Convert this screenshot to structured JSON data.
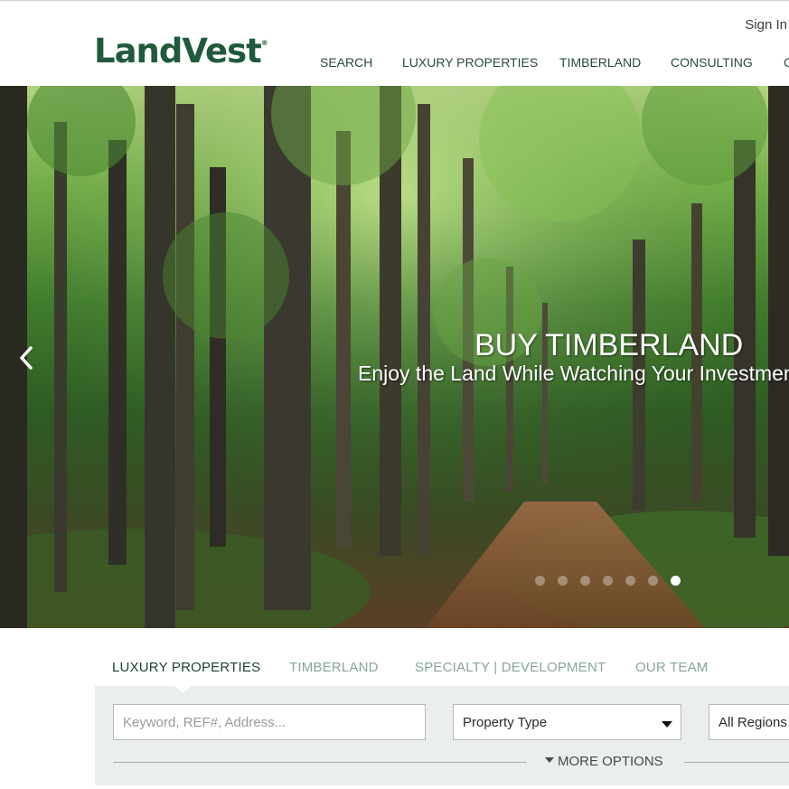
{
  "header": {
    "logo": "LandVest",
    "logo_mark": "®",
    "signin": "Sign In",
    "nav": [
      "SEARCH",
      "LUXURY PROPERTIES",
      "TIMBERLAND",
      "CONSULTING",
      "C"
    ]
  },
  "hero": {
    "title": "BUY TIMBERLAND",
    "subtitle": "Enjoy the Land While Watching Your Investmen",
    "prev_icon": "chevron-left-icon",
    "slides_total": 7,
    "active_slide": 7
  },
  "search": {
    "tabs": [
      "LUXURY PROPERTIES",
      "TIMBERLAND",
      "SPECIALTY | DEVELOPMENT",
      "OUR TEAM"
    ],
    "active_tab": 0,
    "keyword_placeholder": "Keyword, REF#, Address...",
    "property_type": "Property Type",
    "region": "All Regions",
    "more_options": "MORE OPTIONS"
  },
  "colors": {
    "brand_green": "#1f5a3d",
    "nav_text": "#2b4a3c",
    "inactive_tab": "#8aa596",
    "panel_bg": "#ebefec"
  }
}
